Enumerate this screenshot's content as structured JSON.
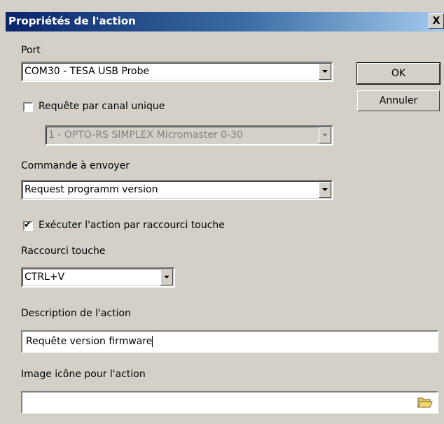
{
  "window": {
    "title": "Propriétés de l'action",
    "close_label": "X"
  },
  "port": {
    "label": "Port",
    "value": "COM30 - TESA USB Probe"
  },
  "single_channel": {
    "label": "Requête par canal unique",
    "checked": false,
    "channel_value": "1 - OPTO-RS SIMPLEX Micromaster 0-30"
  },
  "command": {
    "label": "Commande à envoyer",
    "value": "Request programm version"
  },
  "shortcut_exec": {
    "label": "Exécuter l'action par raccourci touche",
    "checked": true
  },
  "shortcut": {
    "label": "Raccourci touche",
    "value": "CTRL+V"
  },
  "description": {
    "label": "Description de l'action",
    "value": "Requête version firmware"
  },
  "icon_image": {
    "label": "Image icône pour l'action",
    "value": ""
  },
  "buttons": {
    "ok": "OK",
    "cancel": "Annuler"
  }
}
